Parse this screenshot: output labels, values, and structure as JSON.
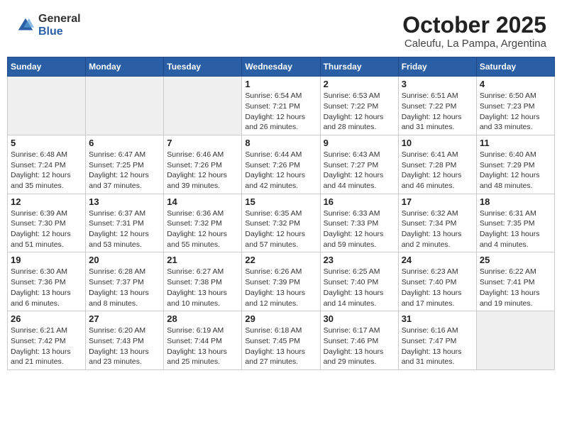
{
  "logo": {
    "general": "General",
    "blue": "Blue"
  },
  "title": "October 2025",
  "location": "Caleufu, La Pampa, Argentina",
  "days_of_week": [
    "Sunday",
    "Monday",
    "Tuesday",
    "Wednesday",
    "Thursday",
    "Friday",
    "Saturday"
  ],
  "weeks": [
    {
      "days": [
        {
          "number": "",
          "info": ""
        },
        {
          "number": "",
          "info": ""
        },
        {
          "number": "",
          "info": ""
        },
        {
          "number": "1",
          "info": "Sunrise: 6:54 AM\nSunset: 7:21 PM\nDaylight: 12 hours\nand 26 minutes."
        },
        {
          "number": "2",
          "info": "Sunrise: 6:53 AM\nSunset: 7:22 PM\nDaylight: 12 hours\nand 28 minutes."
        },
        {
          "number": "3",
          "info": "Sunrise: 6:51 AM\nSunset: 7:22 PM\nDaylight: 12 hours\nand 31 minutes."
        },
        {
          "number": "4",
          "info": "Sunrise: 6:50 AM\nSunset: 7:23 PM\nDaylight: 12 hours\nand 33 minutes."
        }
      ]
    },
    {
      "days": [
        {
          "number": "5",
          "info": "Sunrise: 6:48 AM\nSunset: 7:24 PM\nDaylight: 12 hours\nand 35 minutes."
        },
        {
          "number": "6",
          "info": "Sunrise: 6:47 AM\nSunset: 7:25 PM\nDaylight: 12 hours\nand 37 minutes."
        },
        {
          "number": "7",
          "info": "Sunrise: 6:46 AM\nSunset: 7:26 PM\nDaylight: 12 hours\nand 39 minutes."
        },
        {
          "number": "8",
          "info": "Sunrise: 6:44 AM\nSunset: 7:26 PM\nDaylight: 12 hours\nand 42 minutes."
        },
        {
          "number": "9",
          "info": "Sunrise: 6:43 AM\nSunset: 7:27 PM\nDaylight: 12 hours\nand 44 minutes."
        },
        {
          "number": "10",
          "info": "Sunrise: 6:41 AM\nSunset: 7:28 PM\nDaylight: 12 hours\nand 46 minutes."
        },
        {
          "number": "11",
          "info": "Sunrise: 6:40 AM\nSunset: 7:29 PM\nDaylight: 12 hours\nand 48 minutes."
        }
      ]
    },
    {
      "days": [
        {
          "number": "12",
          "info": "Sunrise: 6:39 AM\nSunset: 7:30 PM\nDaylight: 12 hours\nand 51 minutes."
        },
        {
          "number": "13",
          "info": "Sunrise: 6:37 AM\nSunset: 7:31 PM\nDaylight: 12 hours\nand 53 minutes."
        },
        {
          "number": "14",
          "info": "Sunrise: 6:36 AM\nSunset: 7:32 PM\nDaylight: 12 hours\nand 55 minutes."
        },
        {
          "number": "15",
          "info": "Sunrise: 6:35 AM\nSunset: 7:32 PM\nDaylight: 12 hours\nand 57 minutes."
        },
        {
          "number": "16",
          "info": "Sunrise: 6:33 AM\nSunset: 7:33 PM\nDaylight: 12 hours\nand 59 minutes."
        },
        {
          "number": "17",
          "info": "Sunrise: 6:32 AM\nSunset: 7:34 PM\nDaylight: 13 hours\nand 2 minutes."
        },
        {
          "number": "18",
          "info": "Sunrise: 6:31 AM\nSunset: 7:35 PM\nDaylight: 13 hours\nand 4 minutes."
        }
      ]
    },
    {
      "days": [
        {
          "number": "19",
          "info": "Sunrise: 6:30 AM\nSunset: 7:36 PM\nDaylight: 13 hours\nand 6 minutes."
        },
        {
          "number": "20",
          "info": "Sunrise: 6:28 AM\nSunset: 7:37 PM\nDaylight: 13 hours\nand 8 minutes."
        },
        {
          "number": "21",
          "info": "Sunrise: 6:27 AM\nSunset: 7:38 PM\nDaylight: 13 hours\nand 10 minutes."
        },
        {
          "number": "22",
          "info": "Sunrise: 6:26 AM\nSunset: 7:39 PM\nDaylight: 13 hours\nand 12 minutes."
        },
        {
          "number": "23",
          "info": "Sunrise: 6:25 AM\nSunset: 7:40 PM\nDaylight: 13 hours\nand 14 minutes."
        },
        {
          "number": "24",
          "info": "Sunrise: 6:23 AM\nSunset: 7:40 PM\nDaylight: 13 hours\nand 17 minutes."
        },
        {
          "number": "25",
          "info": "Sunrise: 6:22 AM\nSunset: 7:41 PM\nDaylight: 13 hours\nand 19 minutes."
        }
      ]
    },
    {
      "days": [
        {
          "number": "26",
          "info": "Sunrise: 6:21 AM\nSunset: 7:42 PM\nDaylight: 13 hours\nand 21 minutes."
        },
        {
          "number": "27",
          "info": "Sunrise: 6:20 AM\nSunset: 7:43 PM\nDaylight: 13 hours\nand 23 minutes."
        },
        {
          "number": "28",
          "info": "Sunrise: 6:19 AM\nSunset: 7:44 PM\nDaylight: 13 hours\nand 25 minutes."
        },
        {
          "number": "29",
          "info": "Sunrise: 6:18 AM\nSunset: 7:45 PM\nDaylight: 13 hours\nand 27 minutes."
        },
        {
          "number": "30",
          "info": "Sunrise: 6:17 AM\nSunset: 7:46 PM\nDaylight: 13 hours\nand 29 minutes."
        },
        {
          "number": "31",
          "info": "Sunrise: 6:16 AM\nSunset: 7:47 PM\nDaylight: 13 hours\nand 31 minutes."
        },
        {
          "number": "",
          "info": ""
        }
      ]
    }
  ],
  "colors": {
    "header_bg": "#2a5fa5",
    "row_odd": "#ffffff",
    "row_even": "#f5f5f5"
  }
}
